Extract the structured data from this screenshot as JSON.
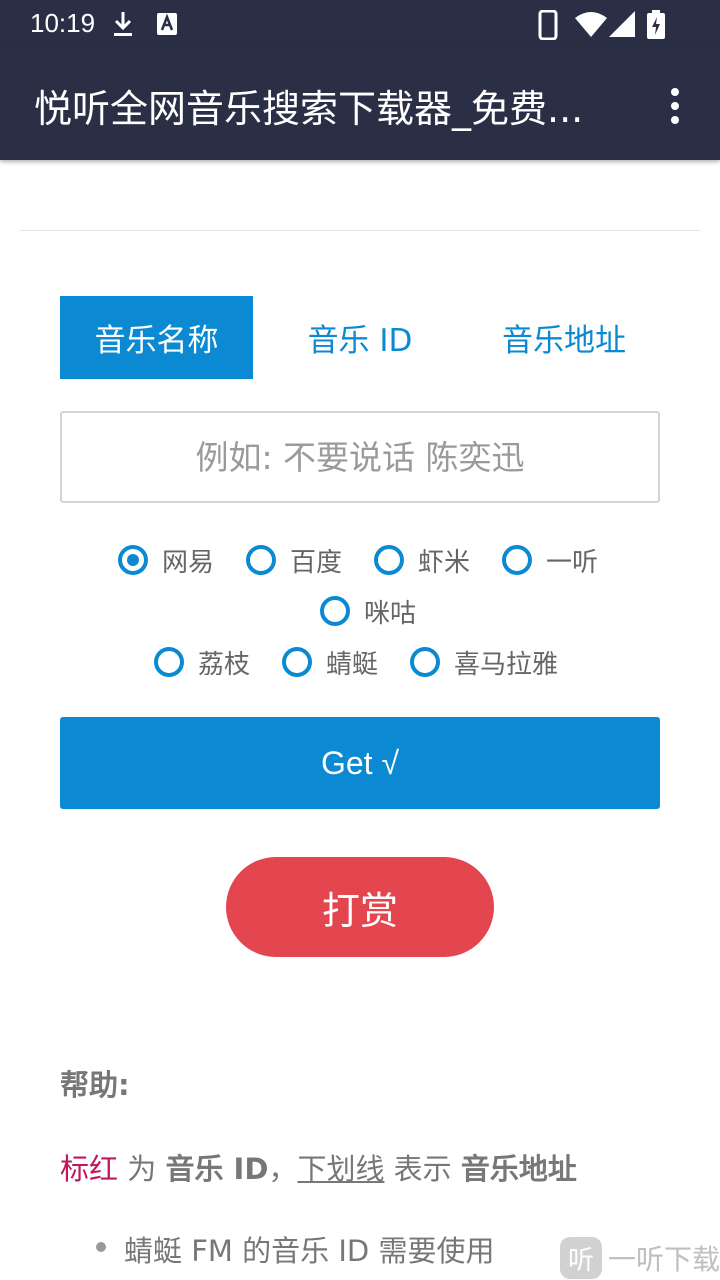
{
  "status_bar": {
    "time": "10:19",
    "icons": [
      "download-icon",
      "a-notification-icon",
      "phone-icon",
      "wifi-icon",
      "signal-icon",
      "battery-charging-icon"
    ]
  },
  "app_bar": {
    "title": "悦听全网音乐搜索下载器_免费...",
    "menu_icon": "more-vertical-icon"
  },
  "tabs": [
    {
      "label": "音乐名称",
      "active": true
    },
    {
      "label": "音乐 ID",
      "active": false
    },
    {
      "label": "音乐地址",
      "active": false
    }
  ],
  "search": {
    "value": "",
    "placeholder": "例如: 不要说话 陈奕迅"
  },
  "sources": [
    {
      "label": "网易",
      "checked": true
    },
    {
      "label": "百度",
      "checked": false
    },
    {
      "label": "虾米",
      "checked": false
    },
    {
      "label": "一听",
      "checked": false
    },
    {
      "label": "咪咕",
      "checked": false
    },
    {
      "label": "荔枝",
      "checked": false
    },
    {
      "label": "蜻蜓",
      "checked": false
    },
    {
      "label": "喜马拉雅",
      "checked": false
    }
  ],
  "actions": {
    "get_label": "Get √",
    "reward_label": "打赏"
  },
  "help": {
    "title": "帮助:",
    "red_text": "标红",
    "text_wei": " 为 ",
    "bold_music_id": "音乐 ID",
    "comma": "，",
    "underline_text": "下划线",
    "text_biaoshi": " 表示 ",
    "bold_music_url": "音乐地址",
    "bullet_1": "蜻蜓 FM 的音乐 ID 需要使用"
  },
  "watermark": {
    "badge": "听",
    "text": "一听下载"
  },
  "colors": {
    "app_bar": "#2b2f45",
    "accent": "#0b8ad3",
    "reward": "#e44650",
    "highlight_red": "#c2185b"
  }
}
